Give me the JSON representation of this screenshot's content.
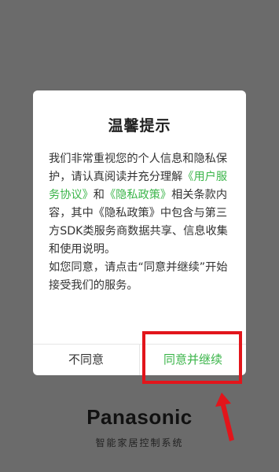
{
  "dialog": {
    "title": "温馨提示",
    "paragraph1_part1": "我们非常重视您的个人信息和隐私保护，请认真阅读并充分理解",
    "link_user_agreement": "《用户服务协议》",
    "and_text": "和",
    "link_privacy_policy": "《隐私政策》",
    "paragraph1_part2": "相关条款内容，其中《隐私政策》中包含与第三方SDK类服务商数据共享、信息收集和使用说明。",
    "paragraph2": "如您同意，请点击“同意并继续”开始接受我们的服务。",
    "disagree_label": "不同意",
    "agree_label": "同意并继续"
  },
  "brand": {
    "logo_text": "Panasonic",
    "tagline": "智能家居控制系统"
  },
  "colors": {
    "accent_green": "#3bb54a",
    "annotation_red": "#e2151b",
    "overlay": "#6b6b6b"
  },
  "icons": {
    "annotation_arrow": "arrow-up-left-icon"
  }
}
